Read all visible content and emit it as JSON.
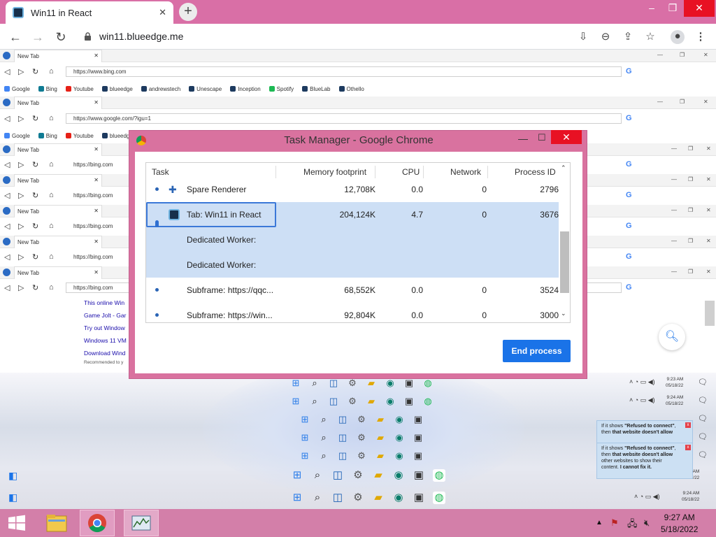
{
  "chrome": {
    "tab_title": "Win11 in React",
    "tab_close": "✕",
    "new_tab": "+",
    "url": "win11.blueedge.me"
  },
  "nested": {
    "tab_title": "New Tab",
    "url_bing_full": "https://www.bing.com",
    "url_google": "https://www.google.com/?igu=1",
    "url_bing_short": "https://bing.com",
    "bookmarks": [
      "Google",
      "Bing",
      "Youtube",
      "blueedge",
      "andrewstech",
      "Unescape",
      "Inception",
      "Spotify",
      "BlueLab",
      "Othello"
    ],
    "bookmark_colors": [
      "#4285f4",
      "#0f7b93",
      "#e62117",
      "#1d3a5f",
      "#1d3a5f",
      "#1d3a5f",
      "#1d3a5f",
      "#1db954",
      "#1d3a5f",
      "#1d3a5f"
    ],
    "snippets": [
      "This online Win",
      "Game Jolt - Gar",
      "Try out Window",
      "Windows 11 VM",
      "Download Wind",
      "Recommended to y"
    ]
  },
  "task_manager": {
    "title": "Task Manager - Google Chrome",
    "columns": [
      "Task",
      "Memory footprint",
      "CPU",
      "Network",
      "Process ID"
    ],
    "rows": [
      {
        "task": "Spare Renderer",
        "memory": "12,708K",
        "cpu": "0.0",
        "network": "0",
        "pid": "2796"
      },
      {
        "task": "Tab: Win11 in React",
        "memory": "204,124K",
        "cpu": "4.7",
        "network": "0",
        "pid": "3676"
      },
      {
        "task": "Dedicated Worker:",
        "memory": "",
        "cpu": "",
        "network": "",
        "pid": ""
      },
      {
        "task": "Dedicated Worker:",
        "memory": "",
        "cpu": "",
        "network": "",
        "pid": ""
      },
      {
        "task": "Subframe: https://qqc...",
        "memory": "68,552K",
        "cpu": "0.0",
        "network": "0",
        "pid": "3524"
      },
      {
        "task": "Subframe: https://win...",
        "memory": "92,804K",
        "cpu": "0.0",
        "network": "0",
        "pid": "3000"
      }
    ],
    "end_process": "End process"
  },
  "desktop": {
    "mini_times": [
      {
        "time": "9:23 AM",
        "date": "05/18/22"
      },
      {
        "time": "9:24 AM",
        "date": "05/18/22"
      },
      {
        "time": "9:24 AM",
        "date": "05/18/22"
      },
      {
        "time": "9:24 AM",
        "date": "05/18/22"
      }
    ],
    "notification": {
      "line1_prefix": "If it shows ",
      "line1_bold": "\"Refused to connect\"",
      "line1_suffix": ",",
      "line2_prefix": "then ",
      "line2_bold": "that website doesn't allow",
      "line3": "other websites to show their",
      "line4_prefix": "content. ",
      "line4_bold": "I cannot fix it."
    }
  },
  "taskbar": {
    "time": "9:27 AM",
    "date": "5/18/2022"
  }
}
